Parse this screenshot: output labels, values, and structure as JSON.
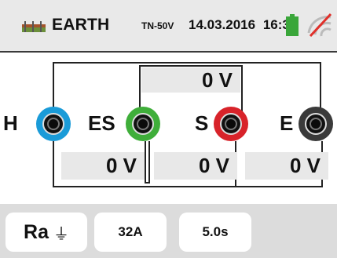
{
  "header": {
    "mode": "EARTH",
    "submode": "TN-50V",
    "date": "14.03.2016",
    "time": "16:34",
    "icons": {
      "logo": "ground-rods-icon",
      "battery": "battery-icon",
      "signal": "no-wireless-icon"
    }
  },
  "measurement": {
    "top_value": "0 V",
    "values": [
      "0 V",
      "0 V",
      "0 V"
    ]
  },
  "terminals": [
    {
      "label": "H",
      "color": "#1a9bd8"
    },
    {
      "label": "ES",
      "color": "#3fae3a"
    },
    {
      "label": "S",
      "color": "#d8232a"
    },
    {
      "label": "E",
      "color": "#3a3a3a"
    }
  ],
  "bottom_bar": {
    "function_label": "Ra",
    "function_icon": "ground-symbol-icon",
    "current_label": "32A",
    "time_label": "5.0s"
  }
}
